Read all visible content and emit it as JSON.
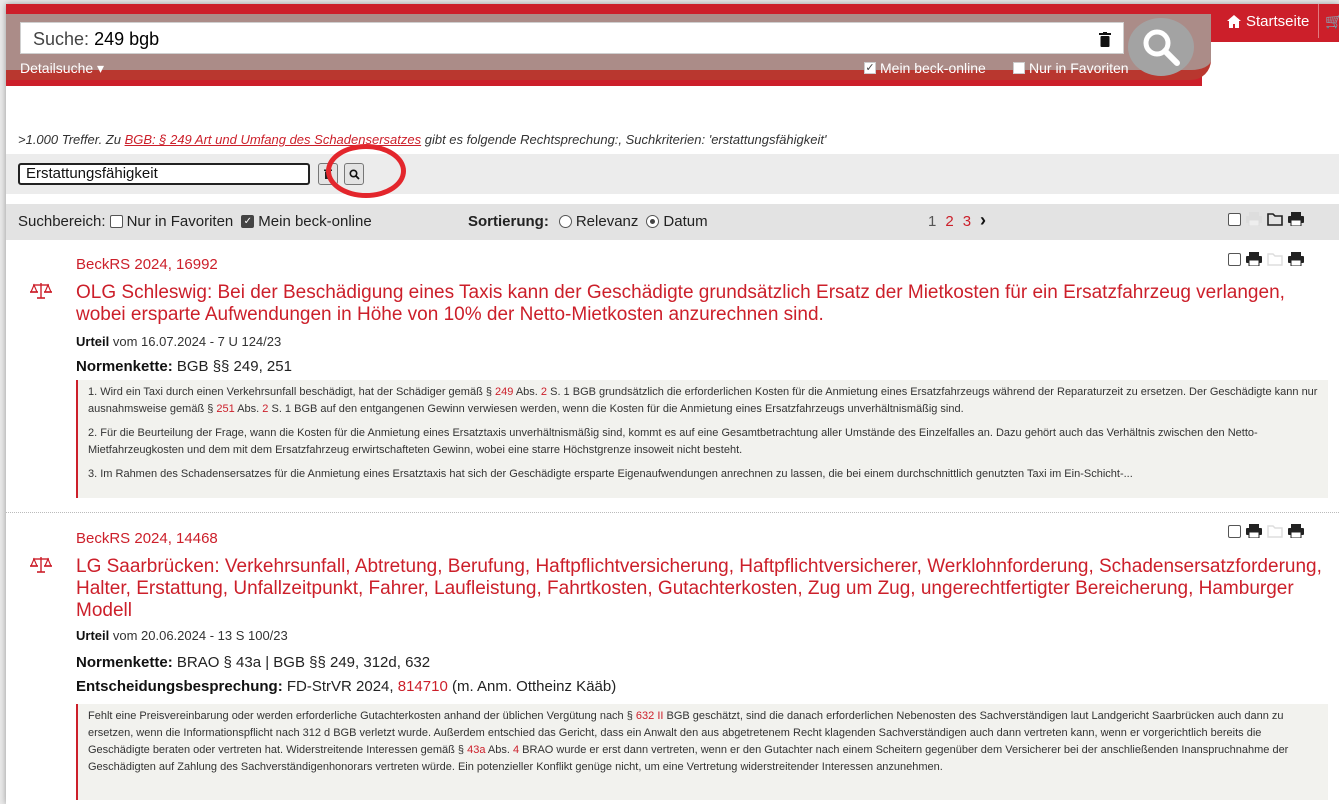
{
  "header": {
    "search_label": "Suche:",
    "search_value": "249 bgb",
    "detailsuche": "Detailsuche ▾",
    "mein_beck_online": "Mein beck-online",
    "nur_in_favoriten": "Nur in Favoriten",
    "startseite": "Startseite",
    "accent": "#cc1f2a"
  },
  "info": {
    "prefix": ">1.000 Treffer. Zu ",
    "link": "BGB: § 249 Art und Umfang des Schadensersatzes",
    "suffix": " gibt es folgende Rechtsprechung:, Suchkriterien: 'erstattungsfähigkeit'"
  },
  "refine": {
    "value": "Erstattungsfähigkeit"
  },
  "filter": {
    "suchbereich_label": "Suchbereich:",
    "nur_in_favoriten": "Nur in Favoriten",
    "mein_beck_online": "Mein beck-online",
    "sortierung_label": "Sortierung:",
    "relevanz": "Relevanz",
    "datum": "Datum",
    "pages": [
      "1",
      "2",
      "3"
    ],
    "next": "›"
  },
  "results": [
    {
      "source": "BeckRS 2024, 16992",
      "title": "OLG Schleswig: Bei der Beschädigung eines Taxis kann der Geschädigte grundsätzlich Ersatz der Mietkosten für ein Ersatzfahrzeug verlangen, wobei ersparte Aufwendungen in Höhe von 10% der Netto-Mietkosten anzurechnen sind.",
      "type": "Urteil",
      "meta": " vom 16.07.2024 - 7 U 124/23",
      "norm_label": "Normenkette:",
      "norm": " BGB §§ 249, 251",
      "p1a": "1. Wird ein Taxi durch einen Verkehrsunfall beschädigt, hat der Schädiger gemäß § ",
      "p1b": "249",
      "p1c": " Abs. ",
      "p1d": "2",
      "p1e": " S. 1 BGB grundsätzlich die erforderlichen Kosten für die Anmietung eines Ersatzfahrzeugs während der Reparaturzeit zu ersetzen. Der Geschädigte kann nur ausnahmsweise gemäß § ",
      "p1f": "251",
      "p1g": " Abs. ",
      "p1h": "2",
      "p1i": " S. 1 BGB auf den entgangenen Gewinn verwiesen werden, wenn die Kosten für die Anmietung eines Ersatzfahrzeugs unverhältnismäßig sind.",
      "p2": "2. Für die Beurteilung der Frage, wann die Kosten für die Anmietung eines Ersatztaxis unverhältnismäßig sind, kommt es auf eine Gesamtbetrachtung aller Umstände des Einzelfalles an. Dazu gehört auch das Verhältnis zwischen den Netto-Mietfahrzeugkosten und dem mit dem Ersatzfahrzeug erwirtschafteten Gewinn, wobei eine starre Höchstgrenze insoweit nicht besteht.",
      "p3": "3. Im Rahmen des Schadensersatzes für die Anmietung eines Ersatztaxis hat sich der Geschädigte ersparte Eigenaufwendungen anrechnen zu lassen, die bei einem durchschnittlich genutzten Taxi im Ein-Schicht-..."
    },
    {
      "source": "BeckRS 2024, 14468",
      "title": "LG Saarbrücken: Verkehrsunfall, Abtretung, Berufung, Haftpflichtversicherung, Haftpflichtversicherer, Werklohnforderung, Schadensersatzforderung, Halter, Erstattung, Unfallzeitpunkt, Fahrer, Laufleistung, Fahrtkosten, Gutachterkosten, Zug um Zug, ungerechtfertigter Bereicherung, Hamburger Modell",
      "type": "Urteil",
      "meta": " vom 20.06.2024 - 13 S 100/23",
      "norm_label": "Normenkette:",
      "norm": " BRAO § 43a | BGB §§ 249, 312d, 632",
      "eb_label": "Entscheidungsbesprechung:",
      "eb_pre": " FD-StrVR 2024, ",
      "eb_link": "814710",
      "eb_post": " (m. Anm. Ottheinz Kääb)",
      "pa": "Fehlt eine Preisvereinbarung oder werden erforderliche Gutachterkosten anhand der üblichen Vergütung nach § ",
      "pb": "632 II",
      "pc": " BGB geschätzt, sind die danach erforderlichen Nebenosten des Sachverständigen laut Landgericht Saarbrücken auch dann zu ersetzen, wenn die Informationspflicht nach 312 d BGB verletzt wurde. Außerdem entschied das Gericht, dass ein Anwalt den aus abgetretenem Recht klagenden Sachverständigen auch dann vertreten kann, wenn er vorgerichtlich bereits die Geschädigte beraten oder vertreten hat. Widerstreitende Interessen gemäß § ",
      "pd": "43a",
      "pe": " Abs. ",
      "pf": "4",
      "pg": " BRAO wurde er erst dann vertreten, wenn er den Gutachter nach einem Scheitern gegenüber dem Versicherer bei der anschließenden Inanspruchnahme der Geschädigten auf Zahlung des Sachverständigenhonorars vertreten würde. Ein potenzieller Konflikt genüge nicht, um eine Vertretung widerstreitender Interessen anzunehmen."
    }
  ]
}
